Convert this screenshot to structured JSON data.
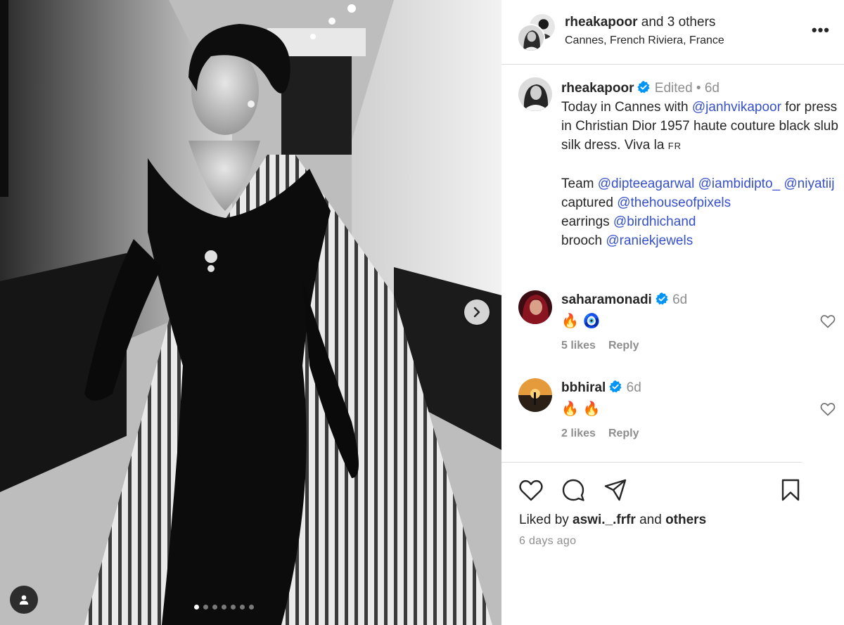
{
  "header": {
    "username": "rheakapoor",
    "others_text": "and 3 others",
    "location": "Cannes, French Riviera, France",
    "more_label": "•••"
  },
  "caption": {
    "username": "rheakapoor",
    "edited": "Edited",
    "separator": "•",
    "time": "6d",
    "line1_text": "Today in Cannes with ",
    "line1_mention": "@janhvikapoor",
    "line1_rest": " for press in Christian Dior 1957 haute couture black slub silk dress. Viva la ",
    "flag": "FR",
    "team_label": "Team ",
    "team_mentions": [
      "@dipteeagarwal",
      "@iambidipto_",
      "@niyatiij"
    ],
    "captured_label": "captured ",
    "captured_mention": "@thehouseofpixels",
    "earrings_label": "earrings ",
    "earrings_mention": "@birdhichand",
    "brooch_label": "brooch ",
    "brooch_mention": "@raniekjewels"
  },
  "comments": [
    {
      "username": "saharamonadi",
      "time": "6d",
      "emoji": "🔥 🧿",
      "likes": "5 likes",
      "reply": "Reply"
    },
    {
      "username": "bbhiral",
      "time": "6d",
      "emoji": "🔥 🔥",
      "likes": "2 likes",
      "reply": "Reply"
    }
  ],
  "likes": {
    "prefix": "Liked by ",
    "user": "aswi._.frfr",
    "middle": " and ",
    "others": "others"
  },
  "timestamp": "6 days ago",
  "carousel": {
    "total_dots": 7,
    "active_index": 0
  },
  "colors": {
    "mention": "#3650c9",
    "verified": "#0095f6",
    "muted": "#8e8e8e"
  },
  "icons": [
    "chevron-right-icon",
    "user-tag-icon",
    "heart-icon",
    "comment-icon",
    "share-icon",
    "bookmark-icon",
    "verified-badge-icon",
    "more-icon"
  ]
}
